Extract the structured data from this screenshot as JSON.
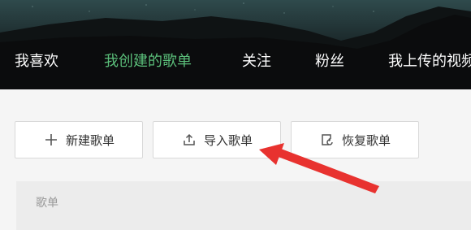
{
  "nav": {
    "items": [
      {
        "label": "我喜欢"
      },
      {
        "label": "我创建的歌单"
      },
      {
        "label": "关注"
      },
      {
        "label": "粉丝"
      },
      {
        "label": "我上传的视频"
      }
    ],
    "active_index": 1,
    "active_color": "#5bbf7a"
  },
  "toolbar": {
    "new_playlist_label": "新建歌单",
    "new_playlist_icon": "plus-icon",
    "import_playlist_label": "导入歌单",
    "import_playlist_icon": "upload-icon",
    "restore_playlist_label": "恢复歌单",
    "restore_playlist_icon": "restore-icon"
  },
  "list": {
    "header": "歌单"
  },
  "annotation": {
    "color": "#e8322f"
  }
}
